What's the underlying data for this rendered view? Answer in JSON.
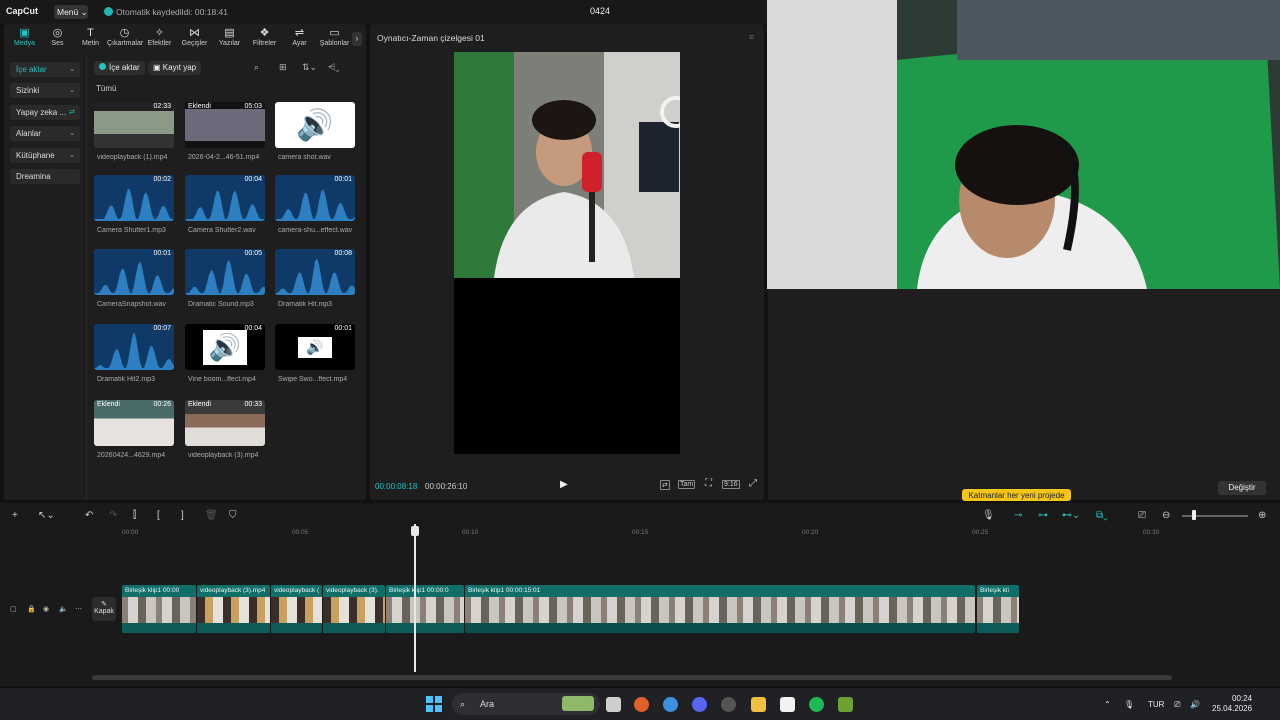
{
  "app": {
    "logo": "CapCut",
    "menu": "Menü",
    "autosave": "Otomatik kaydedildi: 00:18:41",
    "project": "0424"
  },
  "tabs": [
    {
      "label": "Medya",
      "icon": "media-icon"
    },
    {
      "label": "Ses",
      "icon": "audio-icon"
    },
    {
      "label": "Metin",
      "icon": "text-icon"
    },
    {
      "label": "Çıkartmalar",
      "icon": "sticker-icon"
    },
    {
      "label": "Efektler",
      "icon": "effects-icon"
    },
    {
      "label": "Geçişler",
      "icon": "transitions-icon"
    },
    {
      "label": "Yazılar",
      "icon": "captions-icon"
    },
    {
      "label": "Filtreler",
      "icon": "filters-icon"
    },
    {
      "label": "Ayar",
      "icon": "adjust-icon"
    },
    {
      "label": "Şablonlar",
      "icon": "templates-icon"
    }
  ],
  "sidebar": [
    {
      "label": "İçe aktar"
    },
    {
      "label": "Sizinki"
    },
    {
      "label": "Yapay zeka ..."
    },
    {
      "label": "Alanlar"
    },
    {
      "label": "Kütüphane"
    },
    {
      "label": "Dreamina"
    }
  ],
  "media_toolbar": {
    "import": "İçe aktar",
    "record": "Kayıt yap"
  },
  "all_label": "Tümü",
  "media": [
    {
      "name": "videoplayback (1).mp4",
      "dur": "02:33",
      "added": "",
      "kind": "video"
    },
    {
      "name": "2026-04-2...46-51.mp4",
      "dur": "05:03",
      "added": "Eklendi",
      "kind": "video2"
    },
    {
      "name": "camera shot.wav",
      "dur": "",
      "added": "",
      "kind": "speaker"
    },
    {
      "name": "Camera Shutter1.mp3",
      "dur": "00:02",
      "added": "",
      "kind": "wave"
    },
    {
      "name": "Camera Shutter2.wav",
      "dur": "00:04",
      "added": "",
      "kind": "wave"
    },
    {
      "name": "camera-shu...effect.wav",
      "dur": "00:01",
      "added": "",
      "kind": "wave"
    },
    {
      "name": "CameraSnapshot.wav",
      "dur": "00:01",
      "added": "",
      "kind": "wave"
    },
    {
      "name": "Dramatic Sound.mp3",
      "dur": "00:05",
      "added": "",
      "kind": "wave"
    },
    {
      "name": "Dramatik Hit.mp3",
      "dur": "00:08",
      "added": "",
      "kind": "wave"
    },
    {
      "name": "Dramatik Hit2.mp3",
      "dur": "00:07",
      "added": "",
      "kind": "wave"
    },
    {
      "name": "Vine boom...ffect.mp4",
      "dur": "00:04",
      "added": "",
      "kind": "speaker2"
    },
    {
      "name": "Swipe Swo...ffect.mp4",
      "dur": "00:01",
      "added": "",
      "kind": "speaker3"
    },
    {
      "name": "20260424...4629.mp4",
      "dur": "00:26",
      "added": "Eklendi",
      "kind": "person"
    },
    {
      "name": "videoplayback (3).mp4",
      "dur": "00:33",
      "added": "Eklendi",
      "kind": "person2"
    }
  ],
  "player": {
    "title": "Oynatıcı-Zaman çizelgesi 01",
    "current": "00:00:08:18",
    "total": "00:00:26:10",
    "ratio": "9:16",
    "full": "Tam"
  },
  "right": {
    "tooltip": "Katmanlar her yeni projede",
    "change": "Değiştir"
  },
  "timeline": {
    "ruler": [
      "00:00",
      "00:05",
      "00:10",
      "00:15",
      "00:20",
      "00:25",
      "00:30"
    ],
    "cover": "Kapak",
    "clips": [
      {
        "label": "Birleşik klip1  00:00"
      },
      {
        "label": "videoplayback (3).mp4"
      },
      {
        "label": "videoplayback ("
      },
      {
        "label": "videoplayback (3)."
      },
      {
        "label": "Birleşik klip1  00:00:0"
      },
      {
        "label": "Birleşik klip1  00:00:15:01"
      },
      {
        "label": "Birleşik kli"
      }
    ]
  },
  "taskbar": {
    "search": "Ara",
    "lang": "TUR",
    "time": "00:24",
    "date": "25.04.2026"
  }
}
